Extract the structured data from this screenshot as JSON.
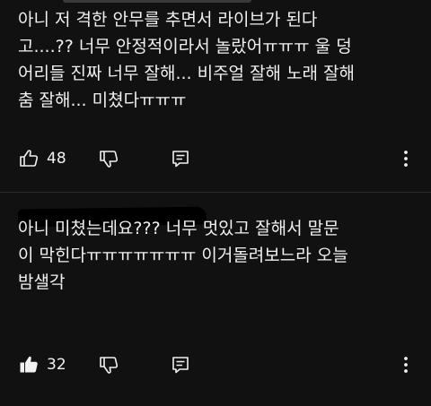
{
  "comments": [
    {
      "text": "아니 저 격한 안무를 추면서 라이브가 된다\n고....?? 너무 안정적이라서 놀랐어ㅠㅠㅠ 울 덩\n어리들 진짜 너무 잘해... 비주얼 잘해 노래 잘해\n춤 잘해... 미쳤다ㅠㅠㅠ",
      "like_count": "48",
      "liked": false
    },
    {
      "author_redacted": true,
      "text": "아니 미쳤는데요???  너무 멋있고 잘해서 말문\n이 막힌다ㅠㅠㅠㅠㅠㅠㅠ 이거돌려보느라 오늘\n밤샐각",
      "like_count": "32",
      "liked": true
    }
  ],
  "icons": {
    "like": "thumbs-up-icon",
    "dislike": "thumbs-down-icon",
    "reply": "reply-comment-icon",
    "more": "more-vertical-icon"
  },
  "colors": {
    "background": "#111111",
    "text": "#f1f1f1",
    "icon": "#f1f1f1",
    "divider": "#2a2a2a"
  }
}
